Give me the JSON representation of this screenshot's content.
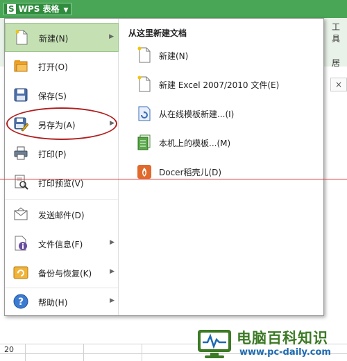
{
  "app": {
    "title": "WPS 表格",
    "logo_letter": "S"
  },
  "background": {
    "toolbar_label": "工具",
    "ribbon_fragment": "居中",
    "tab_close": "×",
    "row_number": "20"
  },
  "file_menu": {
    "items": [
      {
        "label": "新建(N)",
        "icon": "new-doc-icon",
        "submenu": true,
        "active": true
      },
      {
        "label": "打开(O)",
        "icon": "open-folder-icon",
        "submenu": false
      },
      {
        "label": "保存(S)",
        "icon": "save-icon",
        "submenu": false
      },
      {
        "label": "另存为(A)",
        "icon": "save-as-icon",
        "submenu": true
      },
      {
        "label": "打印(P)",
        "icon": "print-icon",
        "submenu": false
      },
      {
        "label": "打印预览(V)",
        "icon": "print-preview-icon",
        "submenu": false
      },
      {
        "label": "发送邮件(D)",
        "icon": "mail-icon",
        "submenu": false
      },
      {
        "label": "文件信息(F)",
        "icon": "file-info-icon",
        "submenu": true
      },
      {
        "label": "备份与恢复(K)",
        "icon": "backup-icon",
        "submenu": true
      },
      {
        "label": "帮助(H)",
        "icon": "help-icon",
        "submenu": true
      }
    ],
    "submenu": {
      "title": "从这里新建文档",
      "items": [
        {
          "label": "新建(N)",
          "icon": "new-doc-icon"
        },
        {
          "label": "新建 Excel 2007/2010 文件(E)",
          "icon": "new-excel-doc-icon"
        },
        {
          "label": "从在线模板新建...(I)",
          "icon": "online-template-icon"
        },
        {
          "label": "本机上的模板...(M)",
          "icon": "local-template-icon"
        },
        {
          "label": "Docer稻壳儿(D)",
          "icon": "docer-icon"
        }
      ]
    }
  },
  "watermark": {
    "title": "电脑百科知识",
    "url": "www.pc-daily.com"
  },
  "colors": {
    "titlebar": "#4aa657",
    "active_item": "#c5e1b4",
    "annotation_red": "#b02020"
  }
}
